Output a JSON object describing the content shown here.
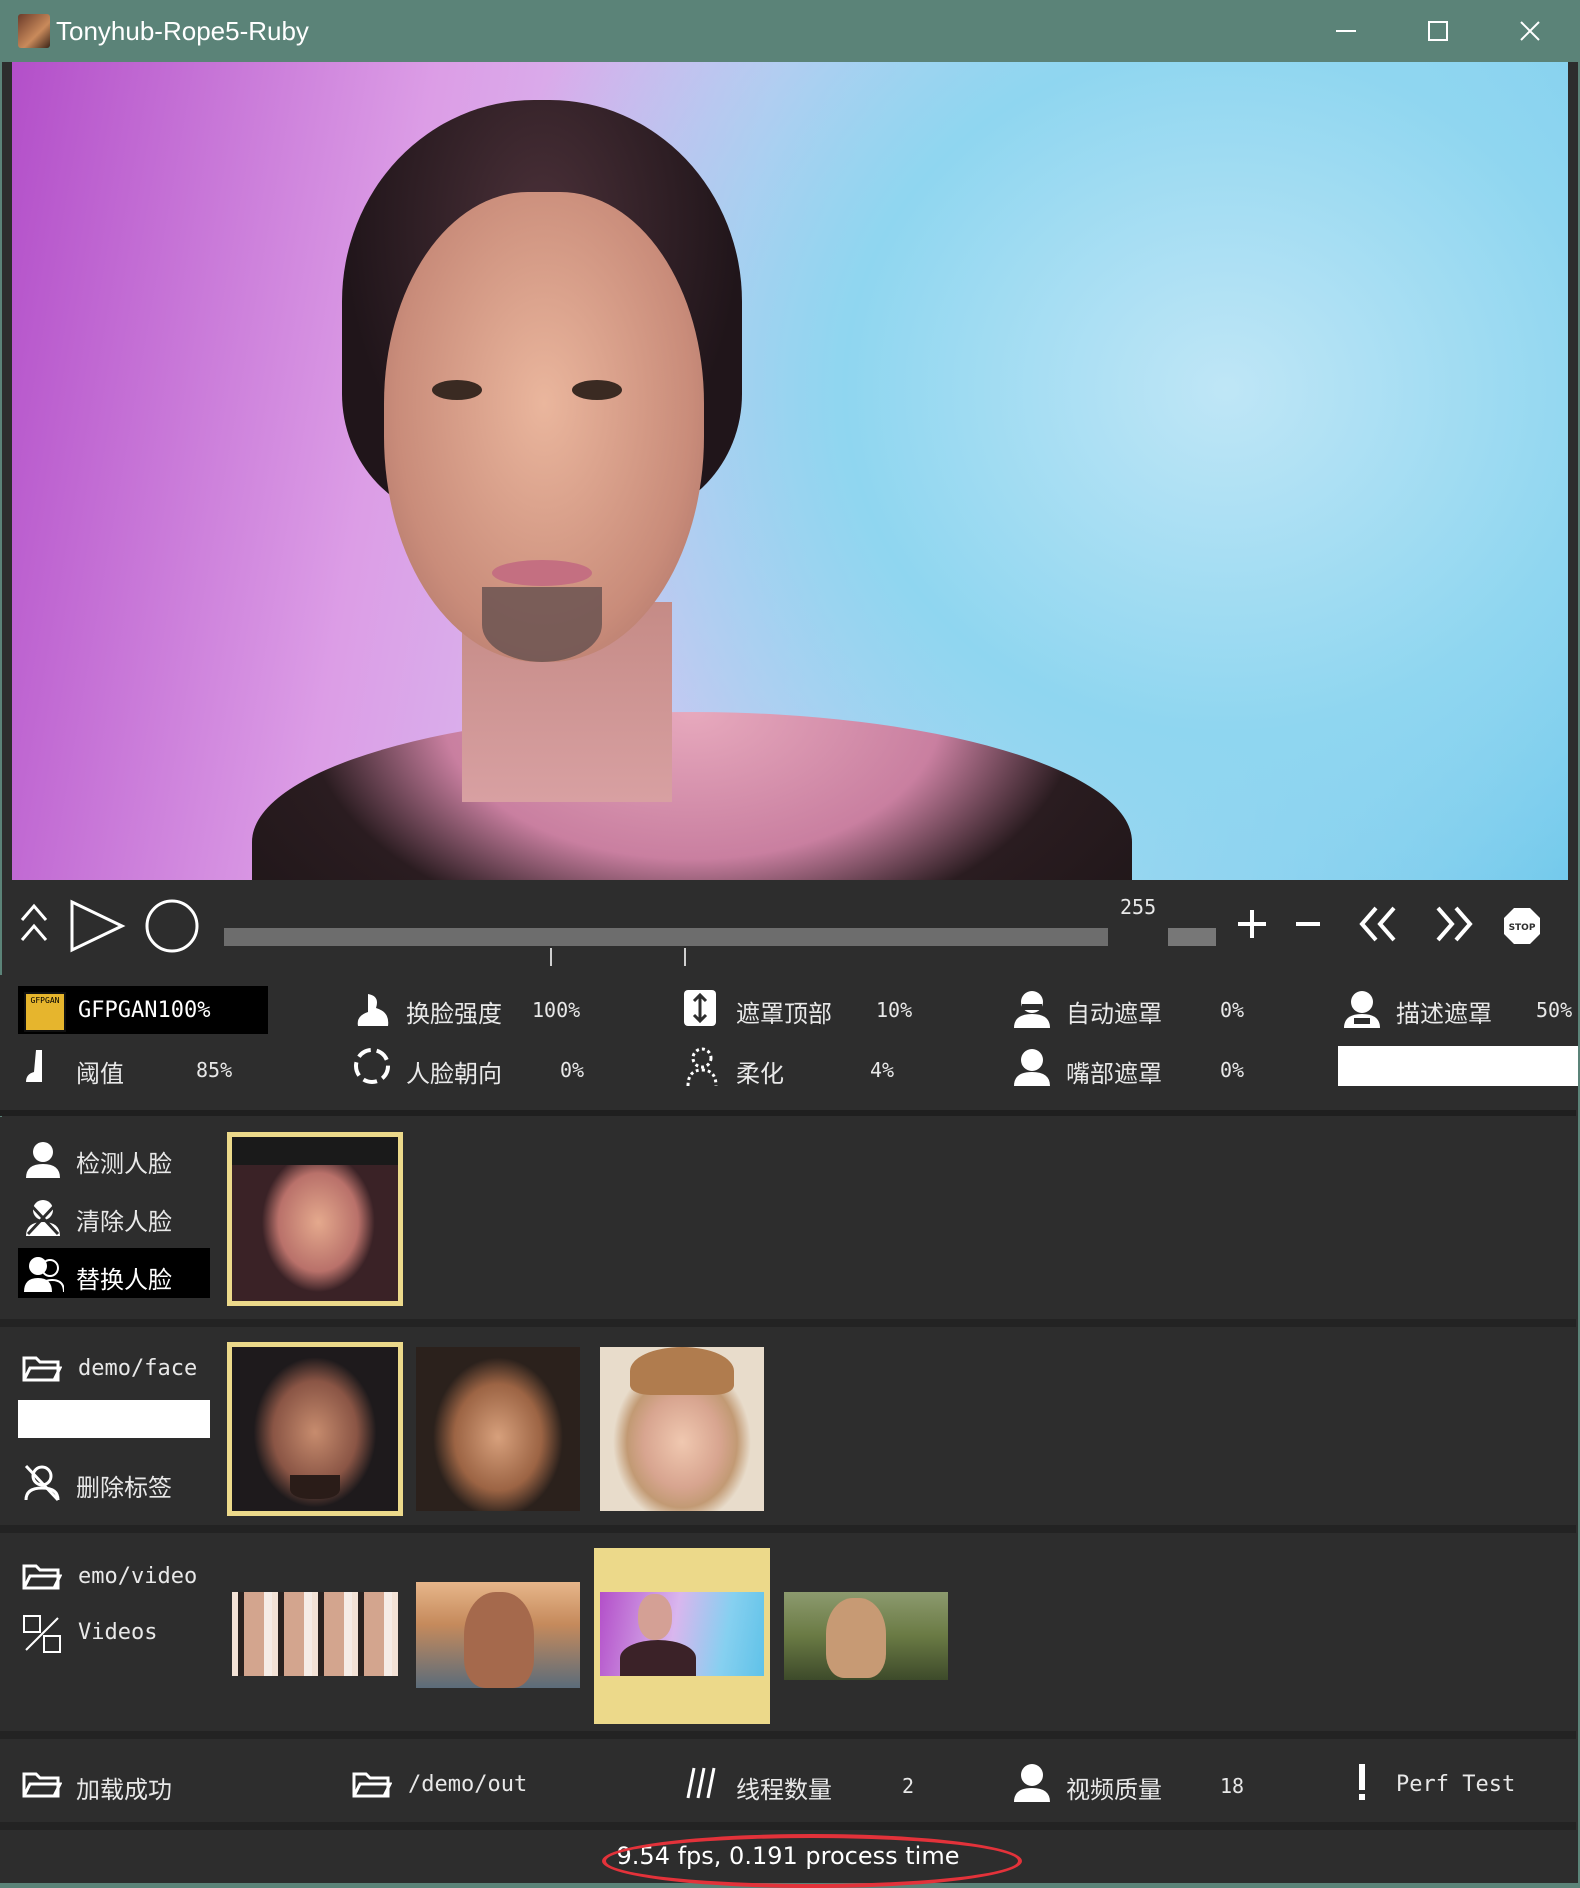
{
  "window": {
    "title": "Tonyhub-Rope5-Ruby",
    "minimize": "—",
    "maximize": "☐",
    "close": "✕"
  },
  "player": {
    "frame_value": "255",
    "timeline_position": 0.0
  },
  "params": {
    "gfpgan": {
      "label": "GFPGAN100%",
      "icon_text": "GFPGAN"
    },
    "threshold": {
      "label": "阈值",
      "value": "85%"
    },
    "swap_strength": {
      "label": "换脸强度",
      "value": "100%"
    },
    "face_orientation": {
      "label": "人脸朝向",
      "value": "0%"
    },
    "mask_top": {
      "label": "遮罩顶部",
      "value": "10%"
    },
    "blur": {
      "label": "柔化",
      "value": "4%"
    },
    "auto_mask": {
      "label": "自动遮罩",
      "value": "0%"
    },
    "mouth_mask": {
      "label": "嘴部遮罩",
      "value": "0%"
    },
    "desc_mask": {
      "label": "描述遮罩",
      "value": "50%"
    }
  },
  "faces": {
    "detect": "检测人脸",
    "clear": "清除人脸",
    "swap": "替换人脸"
  },
  "source": {
    "folder": "demo/face",
    "delete_tag": "删除标签"
  },
  "videos": {
    "folder": "emo/video",
    "label": "Videos"
  },
  "bottom": {
    "load": "加载成功",
    "output": "/demo/out",
    "threads_label": "线程数量",
    "threads_value": "2",
    "quality_label": "视频质量",
    "quality_value": "18",
    "perf": "Perf Test"
  },
  "status": "9.54 fps, 0.191 process time",
  "colors": {
    "highlight": "#ecd98a",
    "panel": "#2d2d2d",
    "titlebar": "#5b8378",
    "annotation": "#e3323a"
  }
}
